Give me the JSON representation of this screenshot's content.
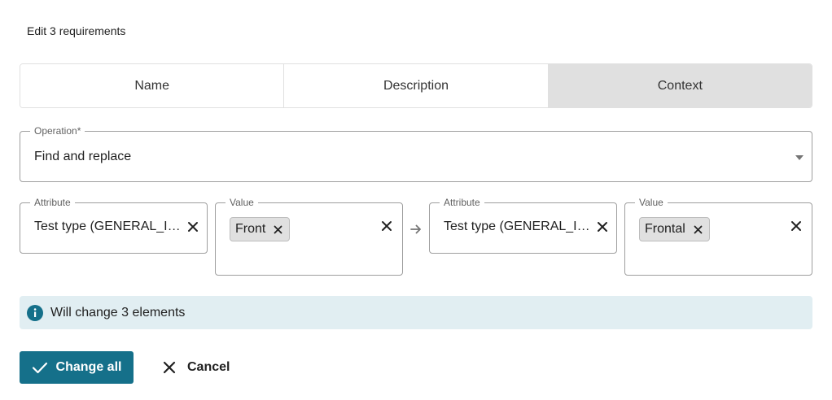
{
  "header": {
    "title": "Edit 3 requirements"
  },
  "tabs": [
    {
      "label": "Name",
      "active": false
    },
    {
      "label": "Description",
      "active": false
    },
    {
      "label": "Context",
      "active": true
    }
  ],
  "operation": {
    "label": "Operation*",
    "value": "Find and replace"
  },
  "find": {
    "attribute": {
      "label": "Attribute",
      "value": "Test type (GENERAL_IN..."
    },
    "value": {
      "label": "Value",
      "chip": "Front"
    }
  },
  "replace": {
    "attribute": {
      "label": "Attribute",
      "value": "Test type (GENERAL_IN..."
    },
    "value": {
      "label": "Value",
      "chip": "Frontal"
    }
  },
  "info": {
    "text": "Will change 3 elements",
    "icon": "info-icon"
  },
  "actions": {
    "primary_label": "Change all",
    "cancel_label": "Cancel"
  },
  "colors": {
    "primary": "#15708a",
    "info_bg": "#e1eef2",
    "active_tab": "#e0e0e0"
  }
}
